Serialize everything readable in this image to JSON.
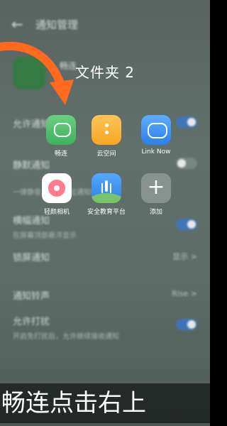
{
  "background": {
    "title": "通知管理",
    "app_name": "畅连",
    "rows": [
      {
        "label": "允许通知",
        "toggle": "on"
      },
      {
        "label": "静默通知",
        "toggle": "off"
      },
      {
        "label": "一律静音，仅在下拉通知中显示"
      },
      {
        "label": "横幅通知",
        "sub": "在屏幕顶部悬浮显示",
        "toggle": "on"
      },
      {
        "label": "锁屏通知",
        "value": "显示 >"
      },
      {
        "label": "通知铃声",
        "value": "Rise >"
      },
      {
        "label": "允许打扰",
        "sub": "开启免打扰后，允许继续接收通知",
        "toggle": "on"
      }
    ]
  },
  "folder": {
    "title": "文件夹 2",
    "apps": [
      {
        "label": "畅连",
        "icon": "chat-icon"
      },
      {
        "label": "云空间",
        "icon": "cloud-space-icon"
      },
      {
        "label": "Link Now",
        "icon": "link-now-icon"
      },
      {
        "label": "轻颜相机",
        "icon": "camera-icon"
      },
      {
        "label": "安全教育平台",
        "icon": "safety-education-icon"
      },
      {
        "label": "添加",
        "icon": "plus-icon"
      }
    ]
  },
  "caption": "畅连点击右上",
  "colors": {
    "arrow": "#ff6a1f",
    "toggle_on": "#3a77c6"
  }
}
